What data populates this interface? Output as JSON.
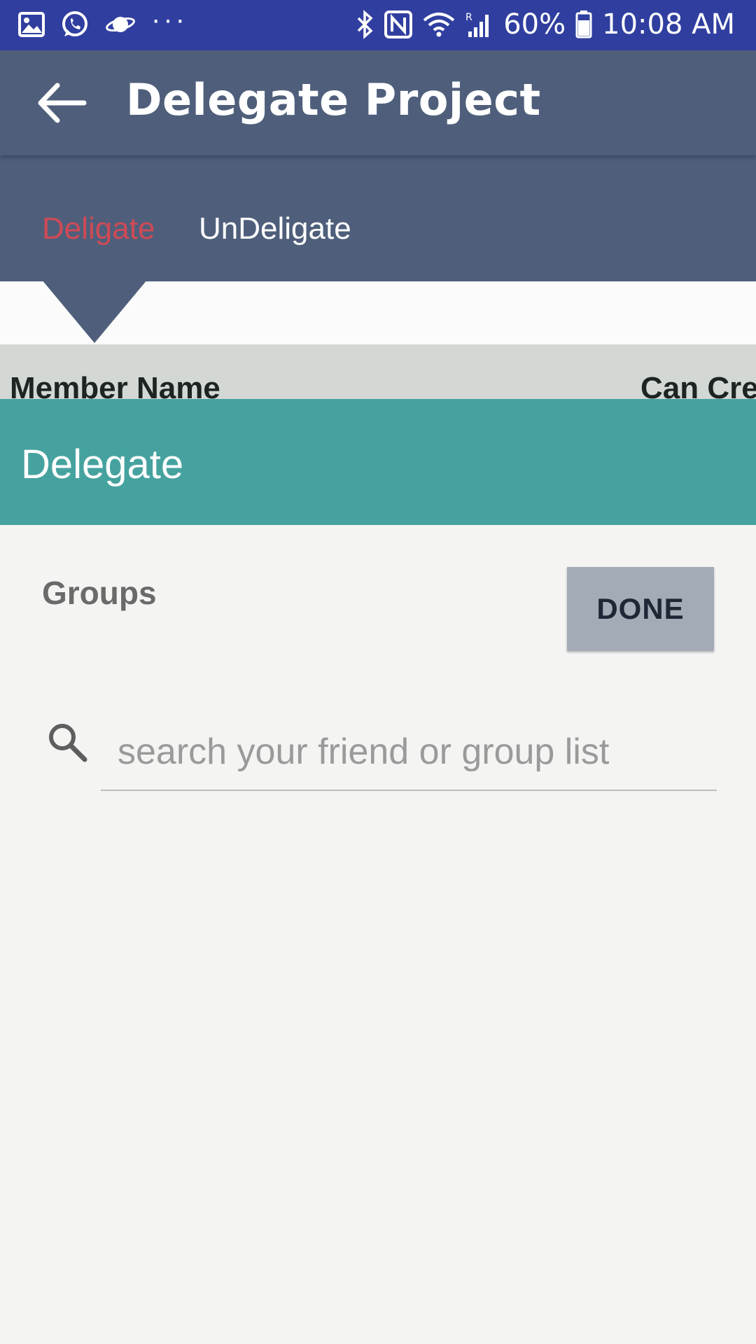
{
  "status_bar": {
    "battery": "60%",
    "time": "10:08 AM",
    "background_color": "#303f9f",
    "left_icons": [
      "gallery-icon",
      "whatsapp-icon",
      "saturn-icon",
      "more-dots-icon"
    ],
    "right_icons": [
      "bluetooth-icon",
      "nfc-icon",
      "wifi-icon",
      "signal-icon",
      "battery-icon"
    ]
  },
  "app_bar": {
    "title": "Delegate Project",
    "background_color": "#4f5f7b"
  },
  "tabs": [
    {
      "label": "Deligate",
      "active": true,
      "active_color": "#cf4a56"
    },
    {
      "label": "UnDeligate",
      "active": false
    }
  ],
  "table": {
    "headers": [
      "Member Name",
      "Can Crea"
    ]
  },
  "dialog": {
    "title": "Delegate",
    "header_color": "#46a29f",
    "groups_label": "Groups",
    "done_label": "DONE",
    "search_placeholder": "search your friend or group list"
  }
}
